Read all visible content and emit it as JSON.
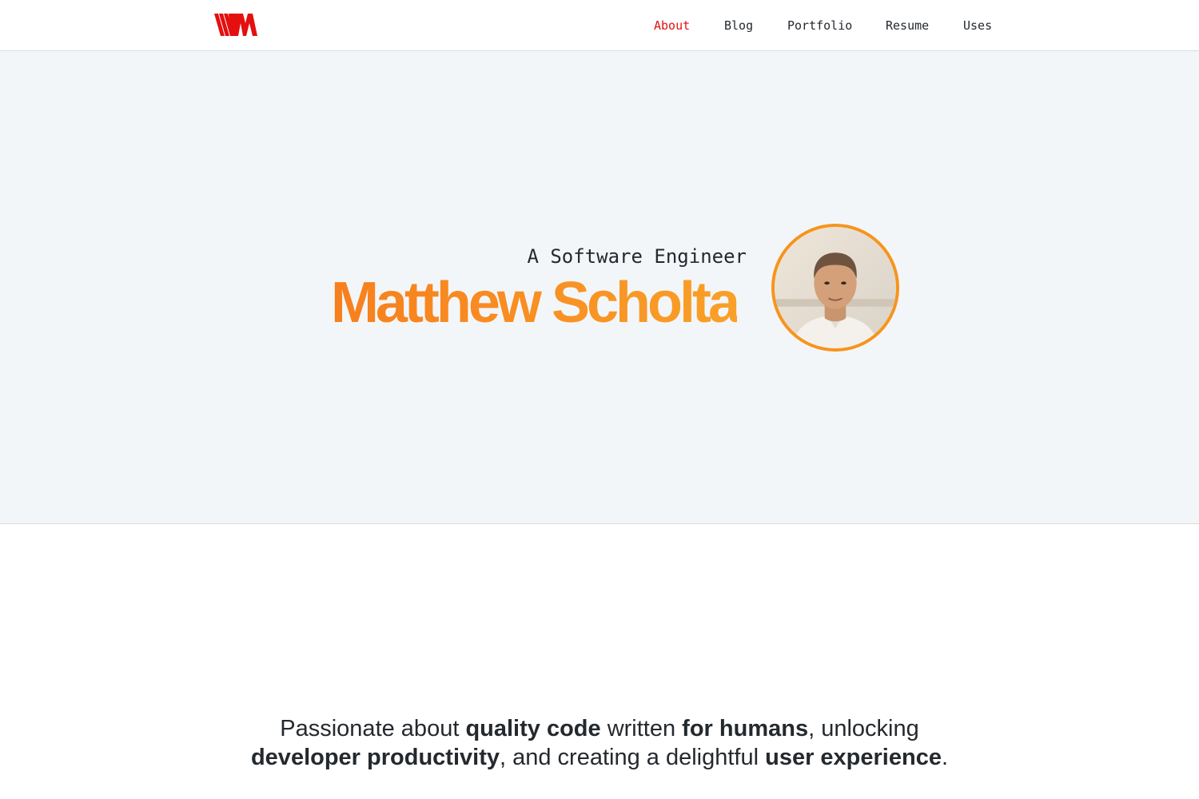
{
  "header": {
    "logo_icon": "vm-monogram-logo-icon",
    "nav": [
      {
        "label": "About",
        "active": true
      },
      {
        "label": "Blog",
        "active": false
      },
      {
        "label": "Portfolio",
        "active": false
      },
      {
        "label": "Resume",
        "active": false
      },
      {
        "label": "Uses",
        "active": false
      }
    ]
  },
  "hero": {
    "subtitle": "A Software Engineer",
    "name": "Matthew Scholta",
    "avatar_icon": "profile-photo"
  },
  "tagline": {
    "t1": "Passionate about ",
    "b1": "quality code",
    "t2": " written ",
    "b2": "for humans",
    "t3": ", unlocking",
    "b3": "developer productivity",
    "t4": ", and creating a delightful ",
    "b4": "user experience",
    "t5": "."
  },
  "colors": {
    "accent_red": "#e40f0f",
    "name_orange": "#f78a1f",
    "avatar_ring": "#f7941d",
    "hero_bg": "#f3f6f9"
  }
}
